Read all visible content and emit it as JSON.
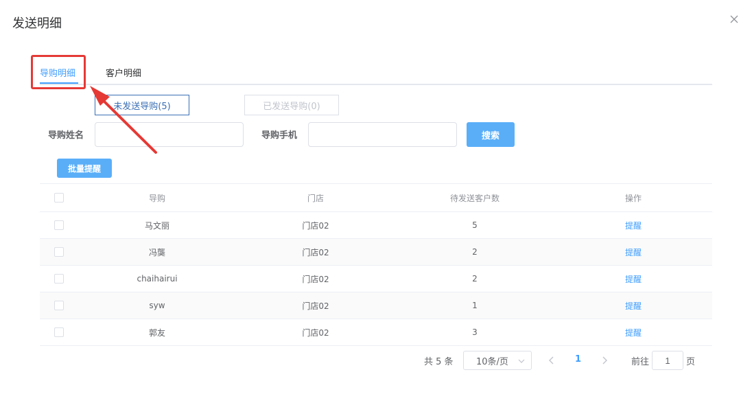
{
  "dialog": {
    "title": "发送明细"
  },
  "tabs": [
    {
      "label": "导购明细"
    },
    {
      "label": "客户明细"
    }
  ],
  "segments": {
    "unsent": "未发送导购(5)",
    "sent": "已发送导购(0)"
  },
  "filters": {
    "name_label": "导购姓名",
    "name_value": "",
    "phone_label": "导购手机",
    "phone_value": "",
    "search_label": "搜索"
  },
  "batch_label": "批量提醒",
  "table": {
    "headers": [
      "导购",
      "门店",
      "待发送客户数",
      "操作"
    ],
    "rows": [
      {
        "guide": "马文丽",
        "store": "门店02",
        "count": "5",
        "action": "提醒"
      },
      {
        "guide": "冯龑",
        "store": "门店02",
        "count": "2",
        "action": "提醒"
      },
      {
        "guide": "chaihairui",
        "store": "门店02",
        "count": "2",
        "action": "提醒"
      },
      {
        "guide": "syw",
        "store": "门店02",
        "count": "1",
        "action": "提醒"
      },
      {
        "guide": "郭友",
        "store": "门店02",
        "count": "3",
        "action": "提醒"
      }
    ]
  },
  "pagination": {
    "total": "共 5 条",
    "page_size": "10条/页",
    "current": "1",
    "goto_label": "前往",
    "goto_value": "1",
    "page_suffix": "页"
  },
  "colors": {
    "accent": "#409eff",
    "annotation": "#e53935"
  },
  "icons": [
    "close-icon",
    "chevron-down-icon",
    "chevron-left-icon",
    "chevron-right-icon"
  ]
}
